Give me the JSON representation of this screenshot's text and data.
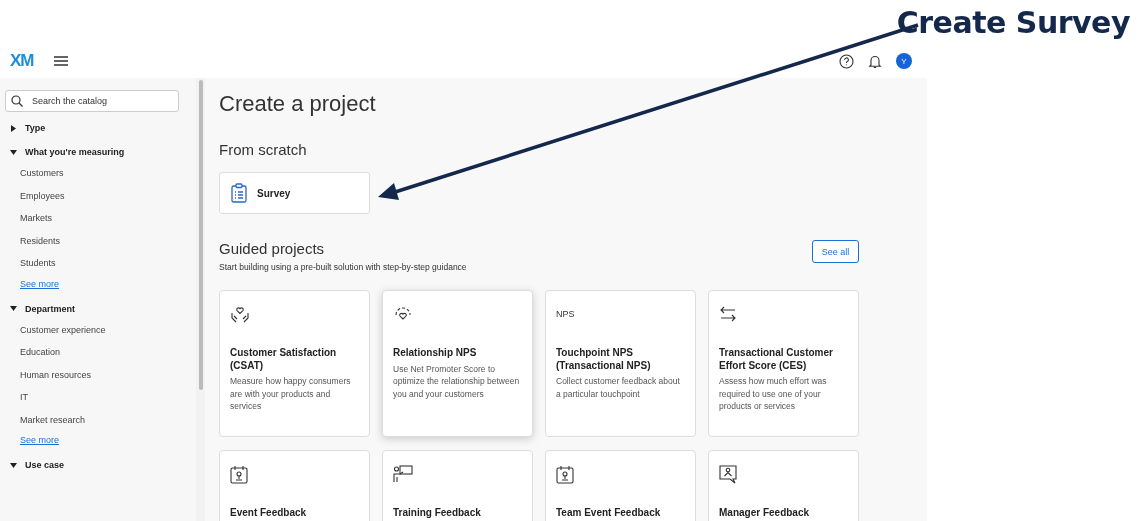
{
  "annotation": {
    "label": "Create Survey"
  },
  "header": {
    "logo": "XM",
    "avatar": "Y"
  },
  "sidebar": {
    "search": {
      "placeholder": "Search the catalog"
    },
    "sections": [
      {
        "title": "Type",
        "expanded": false
      },
      {
        "title": "What you're measuring",
        "expanded": true,
        "children": [
          {
            "label": "Customers"
          },
          {
            "label": "Employees"
          },
          {
            "label": "Markets"
          },
          {
            "label": "Residents"
          },
          {
            "label": "Students"
          }
        ],
        "more": "See more"
      },
      {
        "title": "Department",
        "expanded": true,
        "children": [
          {
            "label": "Customer experience"
          },
          {
            "label": "Education"
          },
          {
            "label": "Human resources"
          },
          {
            "label": "IT"
          },
          {
            "label": "Market research"
          }
        ],
        "more": "See more"
      },
      {
        "title": "Use case",
        "expanded": true
      }
    ]
  },
  "main": {
    "title": "Create a project",
    "scratch_heading": "From scratch",
    "scratch_item": {
      "label": "Survey"
    },
    "guided_heading": "Guided projects",
    "guided_subtitle": "Start building using a pre-built solution with step-by-step guidance",
    "see_all": "See all",
    "cards": [
      {
        "kind": "hands",
        "title": "Customer Satisfaction (CSAT)",
        "description": "Measure how happy consumers are with your products and services",
        "hovered": false
      },
      {
        "kind": "heart",
        "title": "Relationship NPS",
        "description": "Use Net Promoter Score to optimize the relationship between you and your customers",
        "hovered": true
      },
      {
        "kind": "nps",
        "icon_text": "NPS",
        "title": "Touchpoint NPS (Transactional NPS)",
        "description": "Collect customer feedback about a particular touchpoint",
        "hovered": false
      },
      {
        "kind": "arrows",
        "title": "Transactional Customer Effort Score (CES)",
        "description": "Assess how much effort was required to use one of your products or services",
        "hovered": false
      },
      {
        "kind": "badge",
        "title": "Event Feedback",
        "hovered": false
      },
      {
        "kind": "presenter",
        "title": "Training Feedback",
        "hovered": false
      },
      {
        "kind": "badge",
        "title": "Team Event Feedback",
        "hovered": false
      },
      {
        "kind": "chat",
        "title": "Manager Feedback",
        "hovered": false
      }
    ]
  }
}
